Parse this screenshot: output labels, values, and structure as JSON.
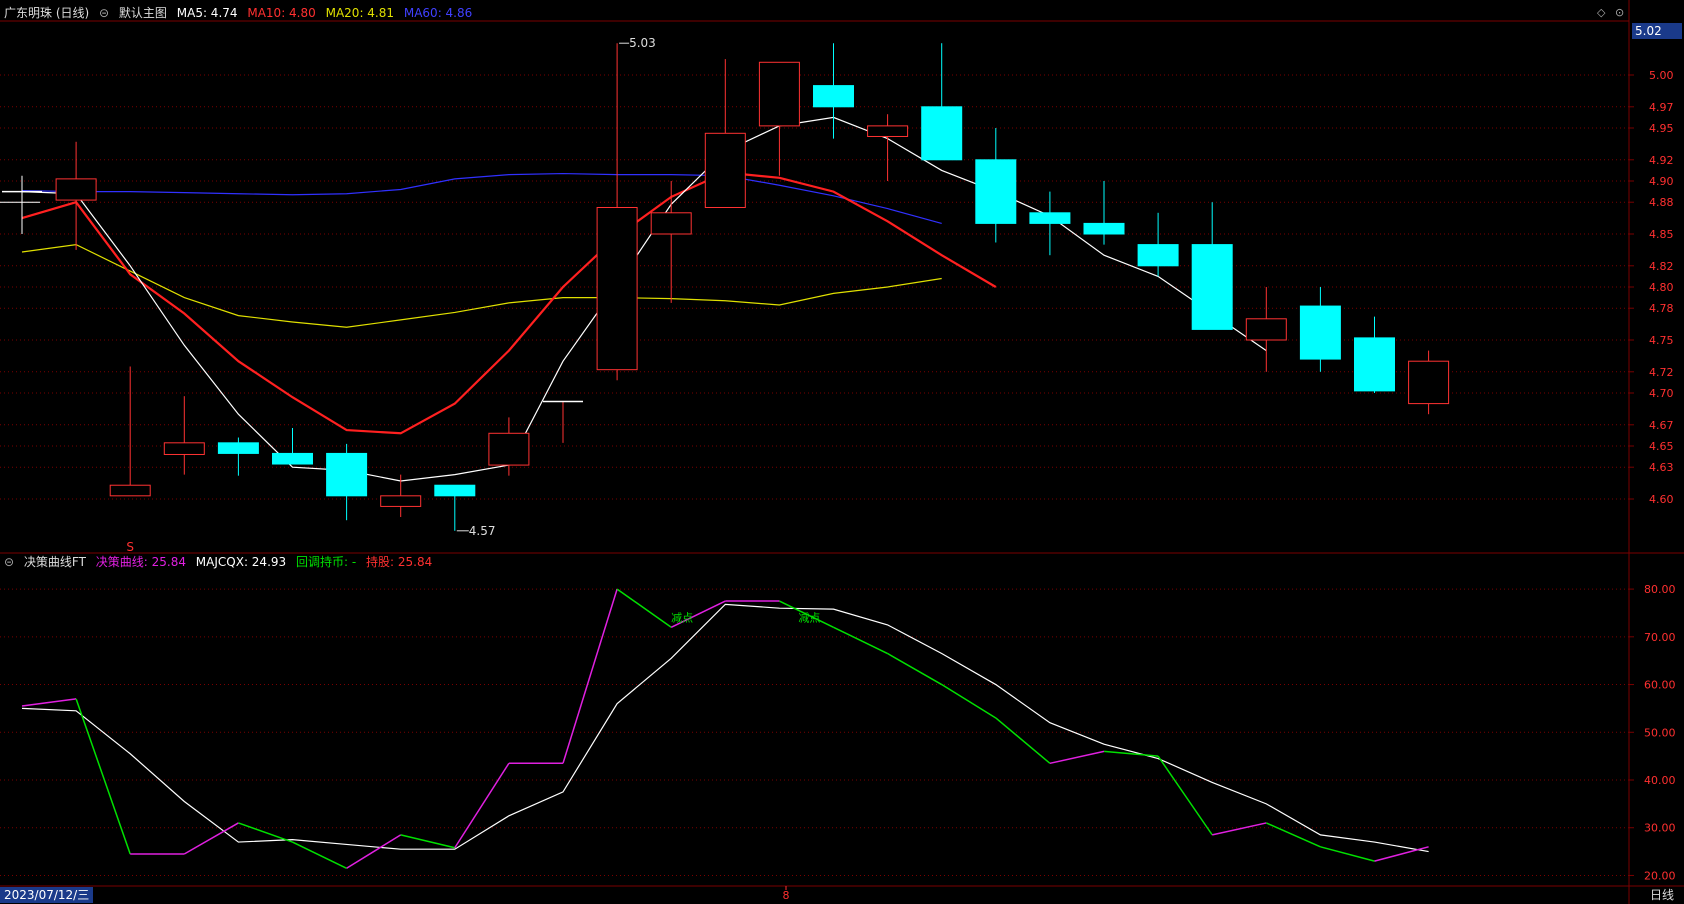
{
  "header_top": {
    "title": "广东明珠 (日线)",
    "template": "默认主图",
    "ma5": "MA5: 4.74",
    "ma10": "MA10: 4.80",
    "ma20": "MA20: 4.81",
    "ma60": "MA60: 4.86"
  },
  "header_bottom": {
    "indicator": "决策曲线FT",
    "curve": "决策曲线: 25.84",
    "majcqx": "MAJCQX: 24.93",
    "pullback": "回调持币: -",
    "hold": "持股: 25.84"
  },
  "footer": {
    "date": "2023/07/12/三",
    "period": "日线",
    "marker": "8"
  },
  "current_price": "5.02",
  "colors": {
    "up": "#ff3232",
    "down": "#00ffff",
    "ma5": "#ffffff",
    "ma10": "#ff2020",
    "ma20": "#e0e000",
    "ma60": "#3030ff",
    "curve": "#e020e0",
    "curve_green": "#00e000",
    "majcqx": "#ffffff",
    "grid": "#7a0000"
  },
  "chart_data": [
    {
      "type": "candlestick",
      "ylim": [
        4.55,
        5.05
      ],
      "yticks": [
        "5.00",
        "4.97",
        "4.95",
        "4.92",
        "4.90",
        "4.88",
        "4.85",
        "4.82",
        "4.80",
        "4.78",
        "4.75",
        "4.72",
        "4.70",
        "4.67",
        "4.65",
        "4.63",
        "4.60"
      ],
      "candles": [
        {
          "o": 4.89,
          "h": 4.9,
          "l": 4.855,
          "c": 4.89
        },
        {
          "o": 4.882,
          "h": 4.937,
          "l": 4.835,
          "c": 4.902
        },
        {
          "o": 4.603,
          "h": 4.725,
          "l": 4.603,
          "c": 4.613
        },
        {
          "o": 4.642,
          "h": 4.697,
          "l": 4.623,
          "c": 4.653
        },
        {
          "o": 4.653,
          "h": 4.658,
          "l": 4.622,
          "c": 4.643
        },
        {
          "o": 4.643,
          "h": 4.667,
          "l": 4.633,
          "c": 4.633
        },
        {
          "o": 4.643,
          "h": 4.652,
          "l": 4.58,
          "c": 4.603
        },
        {
          "o": 4.593,
          "h": 4.623,
          "l": 4.583,
          "c": 4.603
        },
        {
          "o": 4.613,
          "h": 4.613,
          "l": 4.57,
          "c": 4.603
        },
        {
          "o": 4.632,
          "h": 4.677,
          "l": 4.622,
          "c": 4.662
        },
        {
          "o": 4.692,
          "h": 4.692,
          "l": 4.653,
          "c": 4.692
        },
        {
          "o": 4.722,
          "h": 5.03,
          "l": 4.712,
          "c": 4.875
        },
        {
          "o": 4.85,
          "h": 4.9,
          "l": 4.785,
          "c": 4.87
        },
        {
          "o": 4.875,
          "h": 5.015,
          "l": 4.875,
          "c": 4.945
        },
        {
          "o": 4.952,
          "h": 5.012,
          "l": 4.905,
          "c": 5.012
        },
        {
          "o": 4.99,
          "h": 5.03,
          "l": 4.94,
          "c": 4.97
        },
        {
          "o": 4.942,
          "h": 4.963,
          "l": 4.9,
          "c": 4.952
        },
        {
          "o": 4.97,
          "h": 5.03,
          "l": 4.92,
          "c": 4.92
        },
        {
          "o": 4.92,
          "h": 4.95,
          "l": 4.842,
          "c": 4.86
        },
        {
          "o": 4.87,
          "h": 4.89,
          "l": 4.83,
          "c": 4.86
        },
        {
          "o": 4.86,
          "h": 4.9,
          "l": 4.84,
          "c": 4.85
        },
        {
          "o": 4.84,
          "h": 4.87,
          "l": 4.81,
          "c": 4.82
        },
        {
          "o": 4.84,
          "h": 4.88,
          "l": 4.76,
          "c": 4.76
        },
        {
          "o": 4.75,
          "h": 4.8,
          "l": 4.72,
          "c": 4.77
        },
        {
          "o": 4.782,
          "h": 4.8,
          "l": 4.72,
          "c": 4.732
        },
        {
          "o": 4.752,
          "h": 4.772,
          "l": 4.7,
          "c": 4.702
        },
        {
          "o": 4.69,
          "h": 4.74,
          "l": 4.68,
          "c": 4.73
        }
      ],
      "ma5": [
        4.89,
        4.888,
        4.82,
        4.745,
        4.68,
        4.63,
        4.627,
        4.617,
        4.623,
        4.632,
        4.73,
        4.802,
        4.878,
        4.928,
        4.952,
        4.96,
        4.94,
        4.91,
        4.89,
        4.867,
        4.83,
        4.81,
        4.775,
        4.74
      ],
      "ma10": [
        4.865,
        4.88,
        4.812,
        4.775,
        4.73,
        4.696,
        4.665,
        4.662,
        4.69,
        4.74,
        4.8,
        4.848,
        4.885,
        4.908,
        4.903,
        4.89,
        4.862,
        4.83,
        4.8
      ],
      "ma20": [
        4.833,
        4.84,
        4.815,
        4.79,
        4.773,
        4.767,
        4.762,
        4.769,
        4.776,
        4.785,
        4.79,
        4.79,
        4.789,
        4.787,
        4.783,
        4.794,
        4.8,
        4.808
      ],
      "ma60": [
        4.891,
        4.89,
        4.89,
        4.889,
        4.888,
        4.887,
        4.888,
        4.892,
        4.902,
        4.906,
        4.907,
        4.906,
        4.906,
        4.905,
        4.896,
        4.886,
        4.874,
        4.86
      ],
      "annotations": {
        "high": "5.03",
        "low": "4.57",
        "signal": "S"
      }
    },
    {
      "type": "line",
      "ylim": [
        18,
        84
      ],
      "yticks": [
        "80.00",
        "70.00",
        "60.00",
        "50.00",
        "40.00",
        "30.00",
        "20.00"
      ],
      "series": [
        {
          "name": "决策曲线",
          "values": [
            55.5,
            57,
            24.5,
            24.5,
            31,
            27,
            21.5,
            28.5,
            25.8,
            43.5,
            43.5,
            80,
            72,
            77.5,
            77.5,
            72,
            66.5,
            60,
            53,
            43.5,
            46,
            45,
            28.5,
            31,
            26,
            23,
            26
          ]
        },
        {
          "name": "MAJCQX",
          "values": [
            55,
            54.5,
            45.5,
            35.5,
            27,
            27.5,
            26.5,
            25.5,
            25.5,
            32.5,
            37.5,
            56,
            65.5,
            76.8,
            76,
            75.8,
            72.5,
            66.5,
            60,
            52,
            47.5,
            44.5,
            39.5,
            35,
            28.5,
            27,
            25
          ]
        }
      ],
      "labels": [
        "减点",
        "减点"
      ]
    }
  ]
}
